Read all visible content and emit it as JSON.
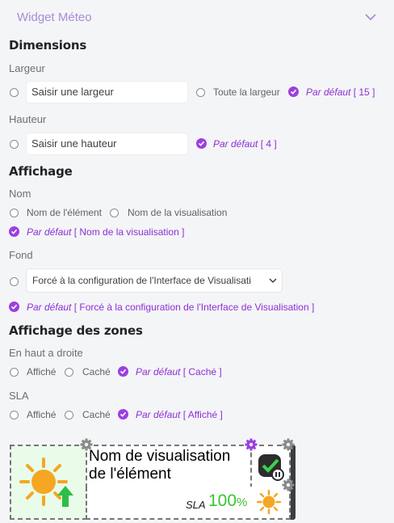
{
  "header": {
    "title": "Widget Méteo",
    "chevron_icon": "chevron-down-icon"
  },
  "dimensions": {
    "title": "Dimensions",
    "largeur": {
      "label": "Largeur",
      "placeholder": "Saisir une largeur",
      "full_width_label": "Toute la largeur",
      "default_prefix": "Par défaut",
      "default_value": "[ 15 ]"
    },
    "hauteur": {
      "label": "Hauteur",
      "placeholder": "Saisir une hauteur",
      "default_prefix": "Par défaut",
      "default_value": "[ 4 ]"
    }
  },
  "affichage": {
    "title": "Affichage",
    "nom": {
      "label": "Nom",
      "option_element": "Nom de l'élément",
      "option_visualisation": "Nom de la visualisation",
      "default_prefix": "Par défaut",
      "default_value": "[ Nom de la visualisation ]"
    },
    "fond": {
      "label": "Fond",
      "selected": "Forcé à la configuration de l'Interface de Visualisati",
      "default_prefix": "Par défaut",
      "default_value": "[ Forcé à la configuration de l'Interface de Visualisation ]"
    }
  },
  "zones": {
    "title": "Affichage des zones",
    "top_right": {
      "label": "En haut a droite",
      "shown": "Affiché",
      "hidden": "Caché",
      "default_prefix": "Par défaut",
      "default_value": "[ Caché ]"
    },
    "sla": {
      "label": "SLA",
      "shown": "Affiché",
      "hidden": "Caché",
      "default_prefix": "Par défaut",
      "default_value": "[ Affiché ]"
    }
  },
  "preview": {
    "name_line1": "Nom de visualisation",
    "name_line2": "de l'élément",
    "sla_label": "SLA",
    "sla_value": "100",
    "sla_unit": "%",
    "weather_icon": "sun-icon",
    "trend_icon": "arrow-up-icon",
    "status_icon": "check-status-icon",
    "settings_icon": "gear-icon",
    "colors": {
      "check": "#9c3fe0",
      "sla_green": "#37c431",
      "sun": "#f5a623",
      "icon_bg": "#e9fbe9"
    }
  }
}
